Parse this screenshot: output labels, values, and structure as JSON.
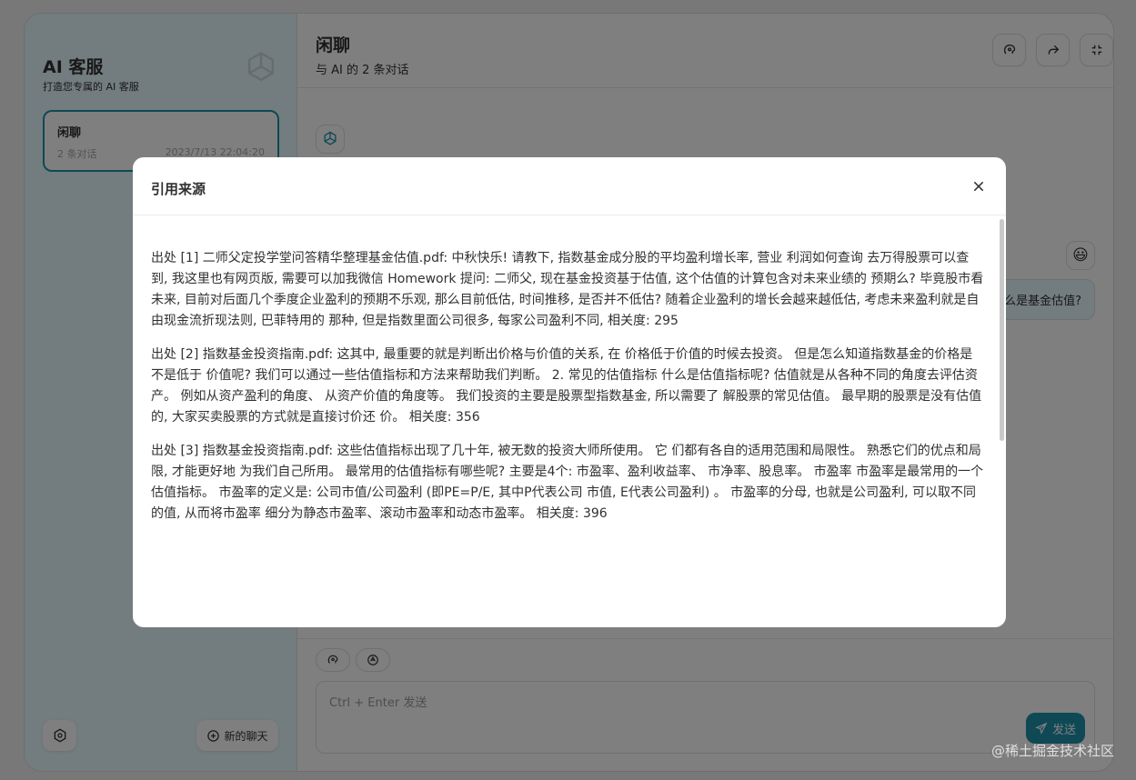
{
  "sidebar": {
    "title": "AI 客服",
    "subtitle": "打造您专属的 AI 客服",
    "chat": {
      "title": "闲聊",
      "count": "2 条对话",
      "time": "2023/7/13 22:04:20"
    },
    "new_chat_label": "新的聊天"
  },
  "header": {
    "title": "闲聊",
    "subtitle": "与 AI 的 2 条对话"
  },
  "messages": {
    "user_text": "什么是基金估值?"
  },
  "input": {
    "placeholder": "Ctrl + Enter 发送",
    "send_label": "发送"
  },
  "modal": {
    "title": "引用来源",
    "sources": [
      "出处 [1] 二师父定投学堂问答精华整理基金估值.pdf: 中秋快乐! 请教下, 指数基金成分股的平均盈利增长率, 营业 利润如何查询 去万得股票可以查到, 我这里也有网页版, 需要可以加我微信 Homework 提问: 二师父, 现在基金投资基于估值, 这个估值的计算包含对未来业绩的 预期么? 毕竟股市看未来, 目前对后面几个季度企业盈利的预期不乐观, 那么目前低估, 时间推移, 是否并不低估? 随着企业盈利的增长会越来越低估, 考虑未来盈利就是自由现金流折现法则, 巴菲特用的 那种, 但是指数里面公司很多, 每家公司盈利不同, 相关度: 295",
      "出处 [2] 指数基金投资指南.pdf: 这其中, 最重要的就是判断出价格与价值的关系, 在 价格低于价值的时候去投资。 但是怎么知道指数基金的价格是不是低于 价值呢? 我们可以通过一些估值指标和方法来帮助我们判断。 2. 常见的估值指标 什么是估值指标呢? 估值就是从各种不同的角度去评估资产。 例如从资产盈利的角度、 从资产价值的角度等。 我们投资的主要是股票型指数基金, 所以需要了 解股票的常见估值。 最早期的股票是没有估值的, 大家买卖股票的方式就是直接讨价还 价。 相关度: 356",
      "出处 [3] 指数基金投资指南.pdf: 这些估值指标出现了几十年, 被无数的投资大师所使用。 它 们都有各自的适用范围和局限性。 熟悉它们的优点和局限, 才能更好地 为我们自己所用。 最常用的估值指标有哪些呢? 主要是4个: 市盈率、盈利收益率、 市净率、股息率。 市盈率 市盈率是最常用的一个估值指标。 市盈率的定义是: 公司市值/公司盈利 (即PE=P/E, 其中P代表公司 市值, E代表公司盈利) 。 市盈率的分母, 也就是公司盈利, 可以取不同的值, 从而将市盈率 细分为静态市盈率、滚动市盈率和动态市盈率。 相关度: 396"
    ]
  },
  "watermark": "@稀土掘金技术社区",
  "colors": {
    "accent": "#1d93ab",
    "sidebar_bg": "#e7f8ff"
  }
}
